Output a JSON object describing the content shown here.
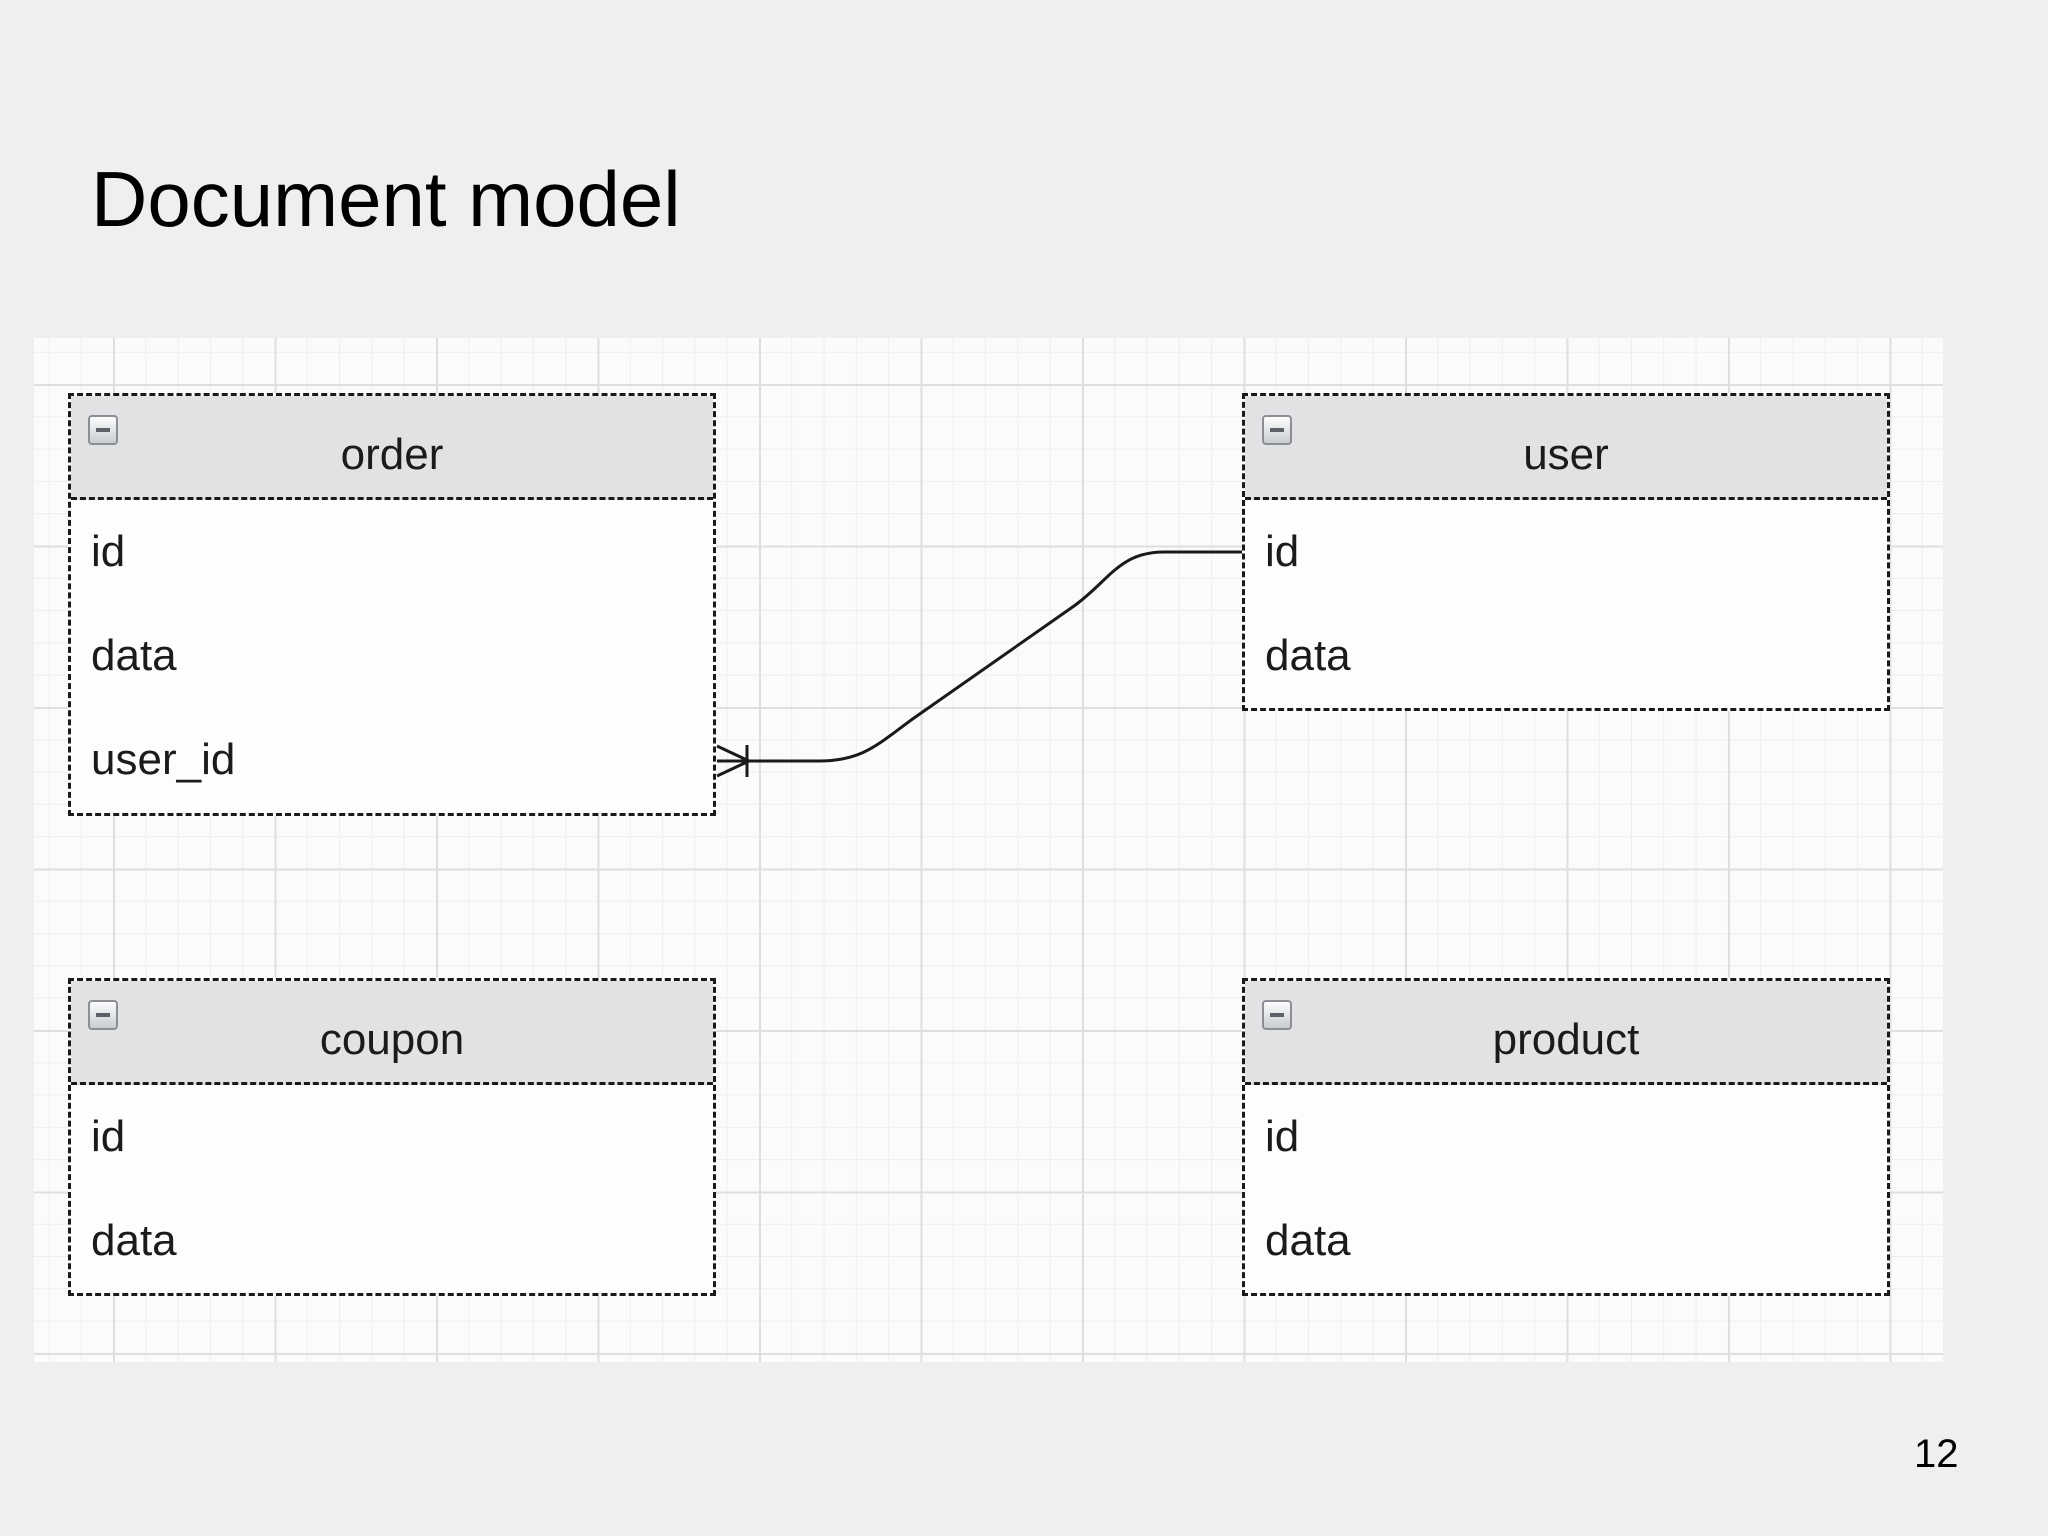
{
  "slide": {
    "title": "Document model",
    "page_number": "12"
  },
  "tables": {
    "order": {
      "name": "order",
      "fields": [
        "id",
        "data",
        "user_id"
      ]
    },
    "user": {
      "name": "user",
      "fields": [
        "id",
        "data"
      ]
    },
    "coupon": {
      "name": "coupon",
      "fields": [
        "id",
        "data"
      ]
    },
    "product": {
      "name": "product",
      "fields": [
        "id",
        "data"
      ]
    }
  },
  "relationships": [
    {
      "from": "order.user_id",
      "to": "user.id",
      "from_cardinality": "one-or-many",
      "to_cardinality": "one"
    }
  ],
  "colors": {
    "background": "#efeef0",
    "canvas": "#fbfbfc",
    "header": "#e2e1e4",
    "border": "#1a1a1a"
  }
}
